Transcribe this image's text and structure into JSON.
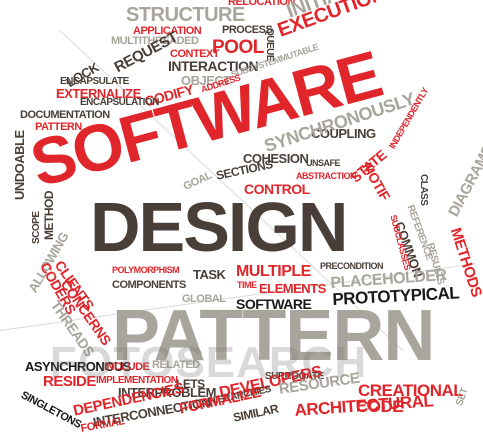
{
  "colors": {
    "red": "#e0262b",
    "dark": "#4a3f38",
    "grey": "#a8a59c",
    "black": "#1a1a1a"
  },
  "headline": {
    "line1": "SOFTWARE",
    "line2": "DESIGN",
    "line3": "PATTERN"
  },
  "watermark": "FOTOSEARCH",
  "words": {
    "structure": "STRUCTURE",
    "relocation": "RELOCATION",
    "application": "APPLICATION",
    "process": "PROCESS",
    "multithreaded": "MULTITHREADED",
    "initialization": "INITIALIZATION",
    "context": "CONTEXT",
    "pool": "POOL",
    "execution": "EXECUTION",
    "lock": "LOCK",
    "request": "REQUEST",
    "interaction": "INTERACTION",
    "queue": "QUEUE",
    "encapsulate": "ENCAPSULATE",
    "object": "OBJECT",
    "subsystem": "SUBSYSTEMMUTABLE",
    "externalize": "EXTERNALIZE",
    "encapsulation": "ENCAPSULATION",
    "codify": "CODIFY",
    "address": "ADDRESS",
    "pattern_small": "PATTERN",
    "documentation": "DOCUMENTATION",
    "independently": "INDEPENDENTLY",
    "undoable": "UNDOABLE",
    "coupling": "COUPLING",
    "synchronously": "SYNCHRONOUSLY",
    "cohesion": "COHESION",
    "sections": "SECTIONS",
    "unsafe": "UNSAFE",
    "abstraction": "ABSTRACTION",
    "state": "STATE",
    "motif": "MOTIF",
    "goal": "GOAL",
    "control": "CONTROL",
    "class": "CLASS",
    "diagrams": "DIAGRAMS",
    "method": "METHOD",
    "scope": "SCOPE",
    "allowing": "ALLOWING",
    "reference": "REFERENCE",
    "common": "COMMON",
    "subclasses": "SUBCLASSES",
    "results": "RESULTS",
    "methods": "METHODS",
    "coders": "CODERS",
    "clients": "CLIENTS",
    "concerns": "CONCERNS",
    "threads": "THREADS",
    "polymorphism": "POLYMORPHISM",
    "task": "TASK",
    "multiple": "MULTIPLE",
    "precondition": "PRECONDITION",
    "components": "COMPONENTS",
    "time": "TIME",
    "elements": "ELEMENTS",
    "placeholder": "PLACEHOLDER",
    "global": "GLOBAL",
    "software": "SOFTWARE",
    "prototypical": "PROTOTYPICAL",
    "asynchronous": "ASYNCHRONOUS",
    "include": "INCLUDE",
    "related": "RELATED",
    "reside": "RESIDE",
    "implementation": "IMPLEMENTATION",
    "lets": "LETS",
    "surrogate": "SURROGATE",
    "developers": "DEVELOPERS",
    "creational": "CREATIONAL",
    "resource": "RESOURCE",
    "code": "CODE",
    "singletons": "SINGLETONS",
    "interproblem": "INTERPROBLEM",
    "hierarchies": "HIERARCHIES",
    "architectural": "ARCHITECTURAL",
    "dependencies": "DEPENDENCIES",
    "interconnection": "INTERCONNECTION",
    "formalize": "FORMALIZE",
    "similar": "SIMILAR",
    "formal": "FORMAL",
    "set": "SET"
  }
}
